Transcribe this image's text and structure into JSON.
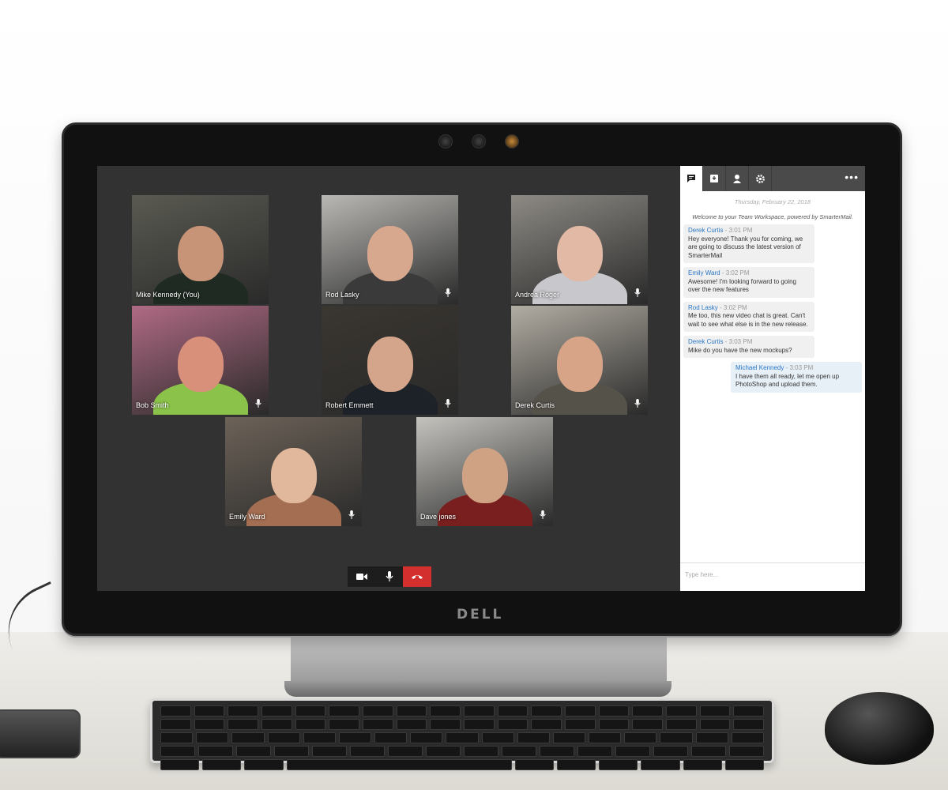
{
  "brand": {
    "logo": "DELL"
  },
  "participants": [
    {
      "name": "Mike Kennedy (You)",
      "show_mic": false,
      "skin": "#c89478",
      "bg": "#5a5a52",
      "shirt": "#1f2a22"
    },
    {
      "name": "Rod Lasky",
      "show_mic": true,
      "skin": "#d8a88e",
      "bg": "#b9b8b4",
      "shirt": "#3b3a3a"
    },
    {
      "name": "Andrea Roger",
      "show_mic": true,
      "skin": "#e2b9a4",
      "bg": "#8d8a84",
      "shirt": "#c8c8cc"
    },
    {
      "name": "Bob Smith",
      "show_mic": true,
      "skin": "#d9907a",
      "bg": "#b06a84",
      "shirt": "#8bc34a"
    },
    {
      "name": "Robert Emmett",
      "show_mic": true,
      "skin": "#d4a58a",
      "bg": "#3a3630",
      "shirt": "#1c2228"
    },
    {
      "name": "Derek Curtis",
      "show_mic": true,
      "skin": "#d8a488",
      "bg": "#b2ada3",
      "shirt": "#55524a"
    },
    {
      "name": "Emily Ward",
      "show_mic": true,
      "skin": "#e2b89c",
      "bg": "#6c6258",
      "shirt": "#a46e52"
    },
    {
      "name": "Dave jones",
      "show_mic": true,
      "skin": "#cfa284",
      "bg": "#c4c3be",
      "shirt": "#7a1f1f"
    }
  ],
  "controls": {
    "video_icon": "video-camera-icon",
    "mic_icon": "microphone-icon",
    "hangup_icon": "phone-hangup-icon",
    "hangup_color": "#d32f2f"
  },
  "chat": {
    "tabs": [
      {
        "icon": "chat-icon",
        "active": true
      },
      {
        "icon": "inbox-download-icon",
        "active": false
      },
      {
        "icon": "person-icon",
        "active": false
      },
      {
        "icon": "gear-icon",
        "active": false
      }
    ],
    "more_icon": "more-horizontal-icon",
    "date": "Thursday, February 22, 2018",
    "welcome": "Welcome to your Team Workspace, powered by SmarterMail.",
    "messages": [
      {
        "author": "Derek Curtis",
        "time": "3:01 PM",
        "text": "Hey everyone! Thank you for coming, we are going to discuss the latest version of SmarterMail",
        "mine": false
      },
      {
        "author": "Emily Ward",
        "time": "3:02 PM",
        "text": "Awesome! I'm looking forward to going over the new features",
        "mine": false
      },
      {
        "author": "Rod Lasky",
        "time": "3:02 PM",
        "text": "Me too, this new video chat is great. Can't wait to see what else is in the new release.",
        "mine": false
      },
      {
        "author": "Derek Curtis",
        "time": "3:03 PM",
        "text": "Mike do you have the new mockups?",
        "mine": false
      },
      {
        "author": "Michael Kennedy",
        "time": "3:03 PM",
        "text": "I have them all ready, let me open up PhotoShop and upload them.",
        "mine": true
      }
    ],
    "input_placeholder": "Type here..."
  }
}
